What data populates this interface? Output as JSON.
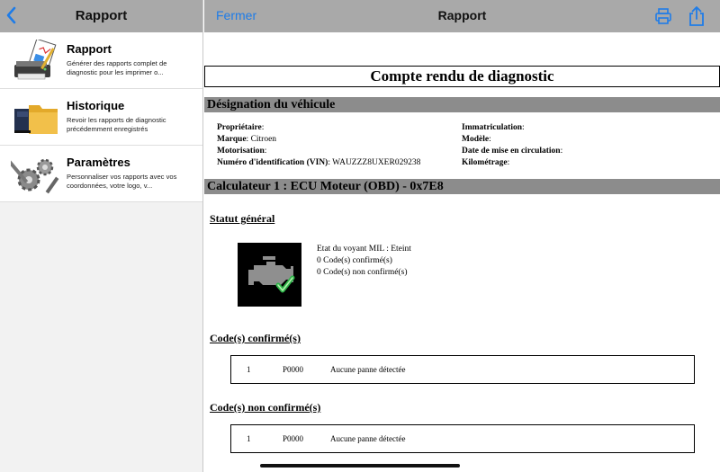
{
  "sidebar": {
    "title": "Rapport",
    "items": [
      {
        "title": "Rapport",
        "desc": "Générer des rapports complet de diagnostic pour les imprimer o...",
        "icon": "printer-report-icon"
      },
      {
        "title": "Historique",
        "desc": "Revoir les rapports de diagnostic précédemment enregistrés",
        "icon": "folder-history-icon"
      },
      {
        "title": "Paramètres",
        "desc": "Personnaliser vos rapports avec vos coordonnées, votre logo, v...",
        "icon": "gears-settings-icon"
      }
    ]
  },
  "header": {
    "close_label": "Fermer",
    "title": "Rapport"
  },
  "doc": {
    "title": "Compte rendu de diagnostic",
    "vehicle_section": "Désignation du véhicule",
    "left": [
      {
        "label": "Propriétaire",
        "value": ""
      },
      {
        "label": "Marque",
        "value": "Citroen"
      },
      {
        "label": "Motorisation",
        "value": ""
      },
      {
        "label": "Numéro d'identification (VIN)",
        "value": "WAUZZZ8UXER029238"
      }
    ],
    "right": [
      {
        "label": "Immatriculation",
        "value": ""
      },
      {
        "label": "Modèle",
        "value": ""
      },
      {
        "label": "Date de mise en circulation",
        "value": ""
      },
      {
        "label": "Kilométrage",
        "value": ""
      }
    ],
    "ecu_section": "Calculateur 1 : ECU Moteur (OBD) - 0x7E8",
    "status_heading": "Statut général",
    "status_lines": [
      "Etat du voyant MIL : Eteint",
      "0 Code(s) confirmé(s)",
      "0 Code(s) non confirmé(s)"
    ],
    "confirmed_heading": "Code(s) confirmé(s)",
    "confirmed_row": {
      "index": "1",
      "code": "P0000",
      "desc": "Aucune panne détectée"
    },
    "unconfirmed_heading": "Code(s) non confirmé(s)",
    "unconfirmed_row": {
      "index": "1",
      "code": "P0000",
      "desc": "Aucune panne détectée"
    }
  },
  "colors": {
    "accent": "#1e7ce8",
    "header_bg": "#a9a9a9",
    "section_bar": "#8c8c8c"
  }
}
